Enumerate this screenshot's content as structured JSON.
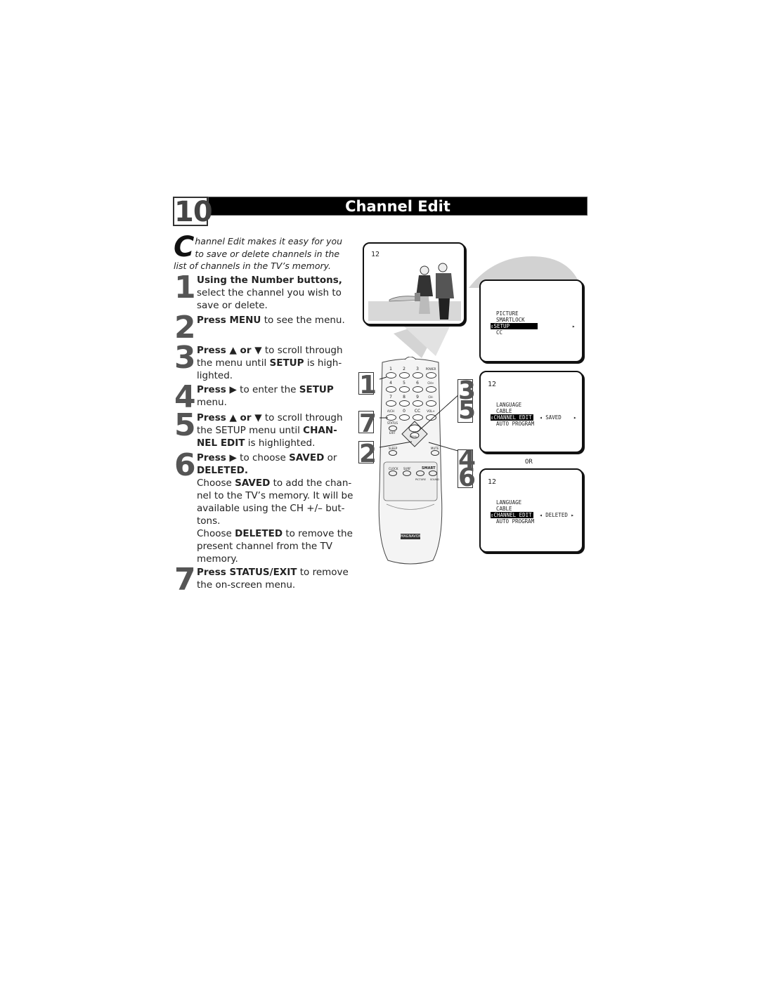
{
  "header": {
    "section_number": "10",
    "title": "Channel Edit"
  },
  "intro": {
    "drop_cap": "C",
    "text": "hannel Edit makes it easy for you to save or delete channels in the list of channels in the TV’s memory."
  },
  "steps": [
    {
      "number": "1",
      "bold": "Using the Number buttons,",
      "text": " select the channel you wish to save or delete."
    },
    {
      "number": "2",
      "bold": "Press MENU",
      "text": " to see the menu."
    },
    {
      "number": "3",
      "bold_a": "Press ▲ or ▼",
      "text_a": " to scroll through the menu until ",
      "bold_b": "SETUP",
      "text_b": " is high- lighted."
    },
    {
      "number": "4",
      "bold_a": "Press ▶",
      "text_a": " to enter the ",
      "bold_b": "SETUP",
      "text_b": " menu."
    },
    {
      "number": "5",
      "bold_a": "Press ▲ or ▼",
      "text_a": " to scroll through the SETUP menu until ",
      "bold_b": "CHAN- NEL EDIT",
      "text_b": " is highlighted."
    },
    {
      "number": "6",
      "bold_a": "Press ▶",
      "text_a": " to choose ",
      "bold_b": "SAVED",
      "text_b": " or ",
      "bold_c": "DELETED.",
      "p2_a": "Choose ",
      "p2_b": "SAVED",
      "p2_c": " to add the chan- nel to the TV’s memory. It will be available using the CH +/– but- tons.",
      "p3_a": "Choose ",
      "p3_b": "DELETED",
      "p3_c": " to remove the present channel from the TV memory."
    },
    {
      "number": "7",
      "bold": "Press STATUS/EXIT",
      "text": " to remove the on-screen menu."
    }
  ],
  "tv_picture": {
    "channel": "12"
  },
  "tv_menu_main": {
    "items": [
      "PICTURE",
      "SMARTLOCK",
      "SETUP",
      "CC"
    ],
    "highlighted": "SETUP",
    "updown_glyph": "⇕",
    "right_arrow": "▸"
  },
  "tv_setup_saved": {
    "channel": "12",
    "items": [
      "LANGUAGE",
      "CABLE",
      "CHANNEL EDIT",
      "AUTO PROGRAM"
    ],
    "highlighted": "CHANNEL EDIT",
    "value": "SAVED",
    "left_arrow": "◂",
    "right_arrow": "▸"
  },
  "or_label": "OR",
  "tv_setup_deleted": {
    "channel": "12",
    "items": [
      "LANGUAGE",
      "CABLE",
      "CHANNEL EDIT",
      "AUTO PROGRAM"
    ],
    "highlighted": "CHANNEL EDIT",
    "value": "DELETED",
    "left_arrow": "◂",
    "right_arrow": "▸"
  },
  "remote": {
    "brand": "MAGNAVOX",
    "rows": [
      [
        "1",
        "2",
        "3",
        "POWER"
      ],
      [
        "4",
        "5",
        "6",
        "CH+"
      ],
      [
        "7",
        "8",
        "9",
        "CH-"
      ],
      [
        "A/CH",
        "0",
        "CC",
        "VOL+"
      ]
    ],
    "status_label": "STATUS",
    "exit_label": "EXIT",
    "menu_label": "MENU",
    "sleep_label": "SLEEP",
    "mute_label": "MUTE",
    "clock_label": "CLOCK",
    "surf_label": "SURF",
    "smart_label": "SMART",
    "picture_label": "PICTURE",
    "sound_label": "SOUND"
  },
  "callouts": {
    "left_top": "1",
    "left_mid": "7",
    "left_bot": "2",
    "right_top": "3\n5",
    "right_bot": "4\n6"
  }
}
